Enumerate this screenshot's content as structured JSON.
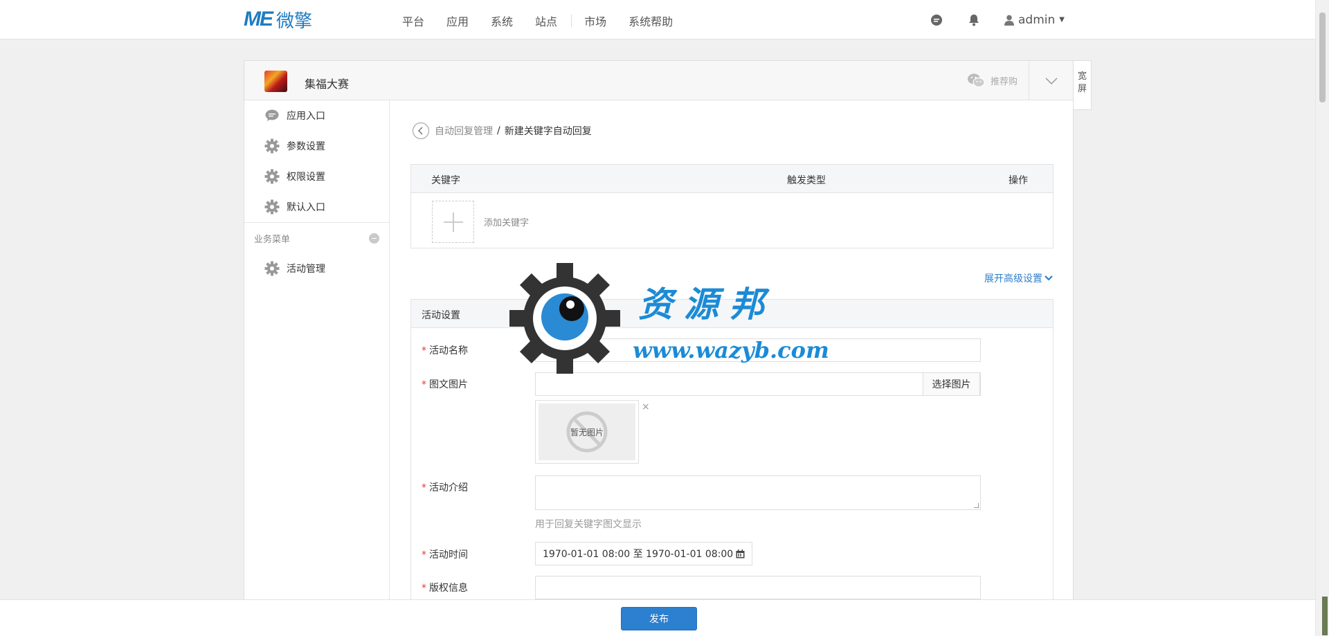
{
  "topnav": {
    "logo_mark": "ME",
    "logo_text": "微擎",
    "items": [
      "平台",
      "应用",
      "系统",
      "站点",
      "市场",
      "系统帮助"
    ],
    "user": "admin"
  },
  "app": {
    "name": "集福大赛",
    "promo": "推荐购",
    "wide_label": "宽屏"
  },
  "sidebar": {
    "items": [
      "应用入口",
      "参数设置",
      "权限设置",
      "默认入口"
    ],
    "group_label": "业务菜单",
    "group_items": [
      "活动管理"
    ]
  },
  "breadcrumb": {
    "parent": "自动回复管理",
    "separator": "/",
    "current": "新建关键字自动回复"
  },
  "keyword_table": {
    "columns": [
      "关键字",
      "触发类型",
      "操作"
    ],
    "add_label": "添加关键字"
  },
  "advanced_link": "展开高级设置",
  "activity": {
    "section_title": "活动设置",
    "name_label": "活动名称",
    "image_label": "图文图片",
    "select_image": "选择图片",
    "no_image": "暂无图片",
    "close_mark": "×",
    "intro_label": "活动介绍",
    "intro_hint": "用于回复关键字图文显示",
    "time_label": "活动时间",
    "time_value": "1970-01-01 08:00 至 1970-01-01 08:00",
    "copyright_label": "版权信息",
    "required_mark": "*"
  },
  "footer": {
    "publish": "发布"
  },
  "watermark": {
    "title": "资源邦",
    "url": "www.wazyb.com"
  },
  "colors": {
    "accent": "#2d7fcf",
    "logo": "#1f7cc2",
    "required": "#ee3333"
  }
}
